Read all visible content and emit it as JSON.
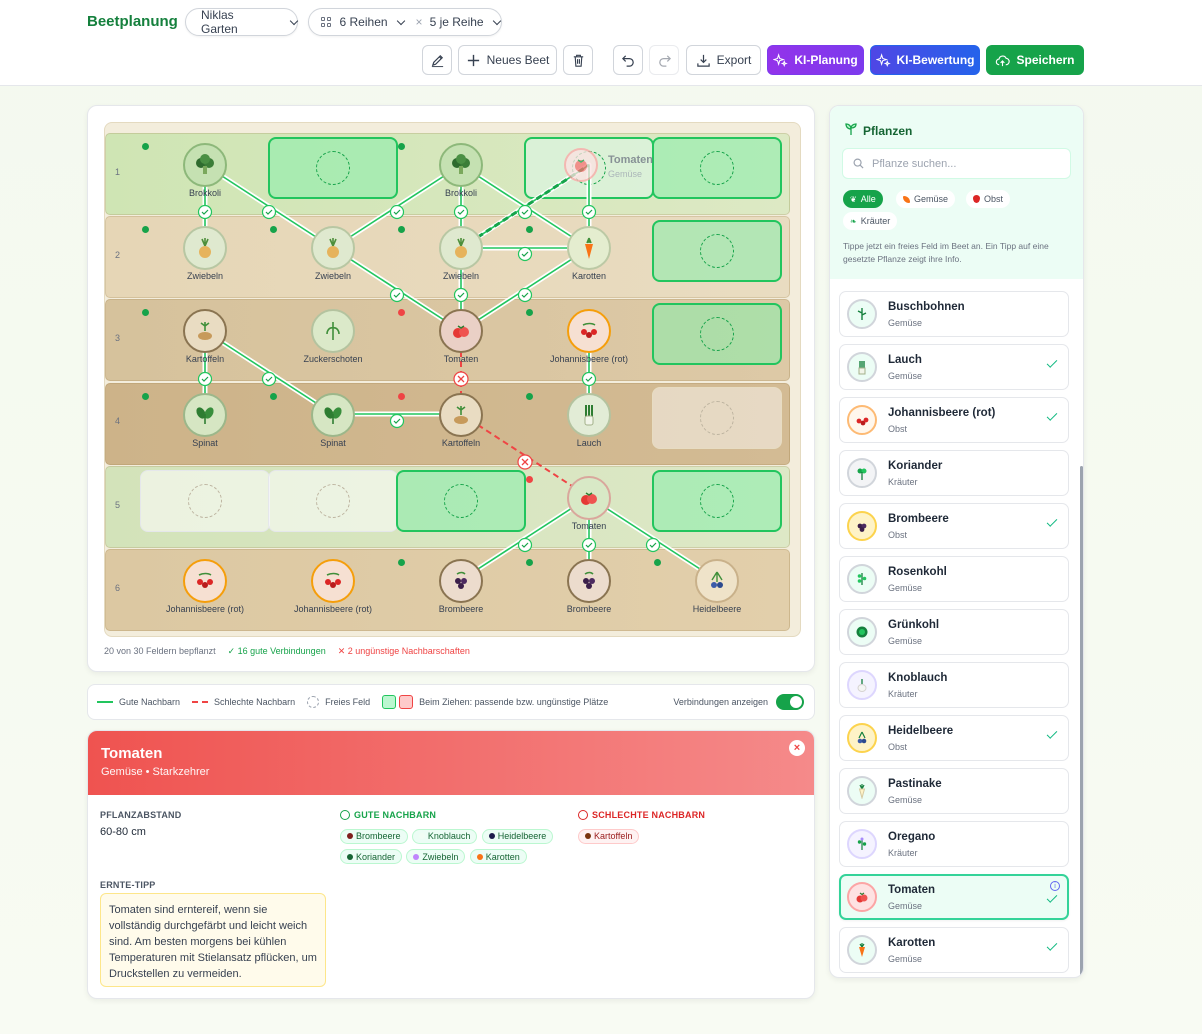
{
  "app": {
    "title": "Beetplanung"
  },
  "toolbar": {
    "garden": "Niklas Garten",
    "rows": "6 Reihen",
    "times": "×",
    "per_row": "5 je Reihe",
    "new_bed": "Neues Beet",
    "export": "Export",
    "ki_plan": "KI-Planung",
    "ki_eval": "KI-Bewertung",
    "save": "Speichern"
  },
  "board": {
    "row_numbers": [
      "1",
      "2",
      "3",
      "4",
      "5",
      "6"
    ],
    "plants": {
      "r1c1": "Brokkoli",
      "r1c3": "Brokkoli",
      "r2c1": "Zwiebeln",
      "r2c2": "Zwiebeln",
      "r2c3": "Zwiebeln",
      "r2c4": "Karotten",
      "r3c1": "Kartoffeln",
      "r3c2": "Zuckerschoten",
      "r3c3": "Tomaten",
      "r3c4": "Johannisbeere (rot)",
      "r4c1": "Spinat",
      "r4c2": "Spinat",
      "r4c3": "Kartoffeln",
      "r4c4": "Lauch",
      "r5c4": "Tomaten",
      "r6c1": "Johannisbeere (rot)",
      "r6c2": "Johannisbeere (rot)",
      "r6c3": "Brombeere",
      "r6c4": "Brombeere",
      "r6c5": "Heidelbeere"
    },
    "drag_ghost": {
      "name": "Tomaten",
      "category": "Gemüse"
    },
    "status": {
      "planted": "20 von 30 Feldern bepflanzt",
      "good": "✓ 16 gute Verbindungen",
      "bad": "✕ 2 ungünstige Nachbarschaften"
    }
  },
  "legend": {
    "good": "Gute Nachbarn",
    "bad": "Schlechte Nachbarn",
    "free": "Freies Feld",
    "drag": "Beim Ziehen: passende bzw. ungünstige Plätze",
    "toggle": "Verbindungen anzeigen",
    "toggle_on": true
  },
  "detail": {
    "title": "Tomaten",
    "subtitle": "Gemüse • Starkzehrer",
    "close": "×",
    "spacing_label": "PFLANZABSTAND",
    "spacing_value": "60-80 cm",
    "good_label": "GUTE NACHBARN",
    "bad_label": "SCHLECHTE NACHBARN",
    "good_neighbors": [
      "Brombeere",
      "Knoblauch",
      "Heidelbeere",
      "Koriander",
      "Zwiebeln",
      "Karotten"
    ],
    "bad_neighbors": [
      "Kartoffeln"
    ],
    "harvest_label": "ERNTE-TIPP",
    "harvest_text": "Tomaten sind erntereif, wenn sie vollständig durchgefärbt und leicht weich sind. Am besten morgens bei kühlen Temperaturen mit Stielansatz pflücken, um Druckstellen zu vermeiden."
  },
  "sidebar": {
    "title": "Pflanzen",
    "search_placeholder": "Pflanze suchen...",
    "filters": [
      "Alle",
      "Gemüse",
      "Obst",
      "Kräuter"
    ],
    "hint": "Tippe jetzt ein freies Feld im Beet an. Ein Tipp auf eine gesetzte Pflanze zeigt ihre Info.",
    "items": [
      {
        "name": "Buschbohnen",
        "cat": "Gemüse"
      },
      {
        "name": "Lauch",
        "cat": "Gemüse"
      },
      {
        "name": "Johannisbeere (rot)",
        "cat": "Obst"
      },
      {
        "name": "Koriander",
        "cat": "Kräuter"
      },
      {
        "name": "Brombeere",
        "cat": "Obst"
      },
      {
        "name": "Rosenkohl",
        "cat": "Gemüse"
      },
      {
        "name": "Grünkohl",
        "cat": "Gemüse"
      },
      {
        "name": "Knoblauch",
        "cat": "Kräuter"
      },
      {
        "name": "Heidelbeere",
        "cat": "Obst"
      },
      {
        "name": "Pastinake",
        "cat": "Gemüse"
      },
      {
        "name": "Oregano",
        "cat": "Kräuter"
      },
      {
        "name": "Tomaten",
        "cat": "Gemüse"
      },
      {
        "name": "Karotten",
        "cat": "Gemüse"
      }
    ]
  },
  "colors": {
    "brand": "#15803d",
    "good": "#22c55e",
    "bad": "#ef4444",
    "ki_plan": "#7c3aed",
    "ki_eval": "#2563eb",
    "save": "#16a34a"
  }
}
